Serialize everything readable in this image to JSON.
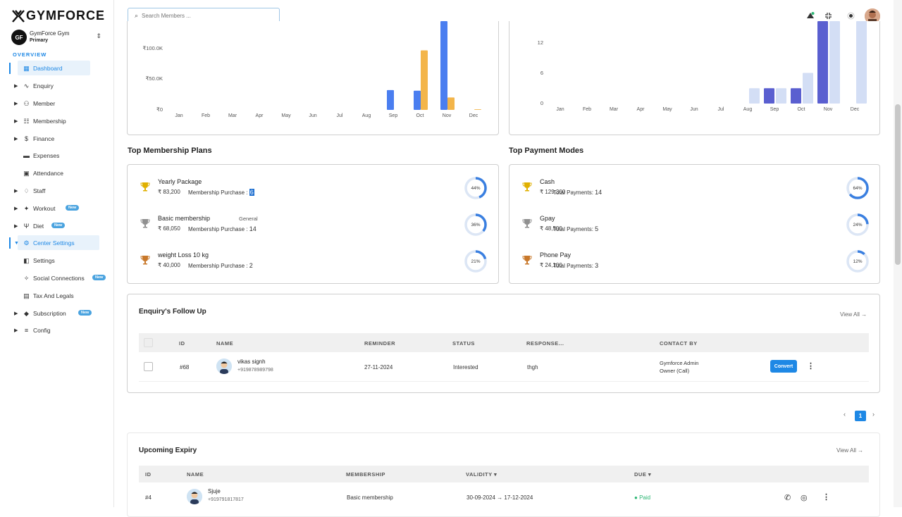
{
  "brand": {
    "logo_text": "GYMFORCE",
    "gym_name": "GymForce Gym",
    "gym_role": "Primary",
    "gym_initials": "GF"
  },
  "sidebar": {
    "section": "OVERVIEW",
    "items": [
      {
        "label": "Dashboard",
        "icon": "grid-icon",
        "new": false
      },
      {
        "label": "Enquiry",
        "icon": "chart-line-icon",
        "new": false
      },
      {
        "label": "Member",
        "icon": "users-icon",
        "new": false
      },
      {
        "label": "Membership",
        "icon": "membership-icon",
        "new": false
      },
      {
        "label": "Finance",
        "icon": "dollar-circle-icon",
        "new": false
      },
      {
        "label": "Expenses",
        "icon": "wallet-icon",
        "new": false
      },
      {
        "label": "Attendance",
        "icon": "calendar-check-icon",
        "new": false
      },
      {
        "label": "Staff",
        "icon": "staff-icon",
        "new": false
      },
      {
        "label": "Workout",
        "icon": "workout-icon",
        "new": true
      },
      {
        "label": "Diet",
        "icon": "utensils-icon",
        "new": true
      },
      {
        "label": "Center Settings",
        "icon": "settings-icon",
        "new": false
      },
      {
        "label": "Settings",
        "icon": "toggle-icon",
        "new": false
      },
      {
        "label": "Social Connections",
        "icon": "social-icon",
        "new": true
      },
      {
        "label": "Tax And Legals",
        "icon": "document-icon",
        "new": false
      },
      {
        "label": "Subscription",
        "icon": "tag-icon",
        "new": true
      },
      {
        "label": "Config",
        "icon": "sliders-icon",
        "new": false
      }
    ],
    "new_badge": "New"
  },
  "search": {
    "placeholder": "Search Members ..."
  },
  "chart_data": [
    {
      "type": "bar",
      "categories": [
        "Jan",
        "Feb",
        "Mar",
        "Apr",
        "May",
        "Jun",
        "Jul",
        "Aug",
        "Sep",
        "Oct",
        "Nov",
        "Dec"
      ],
      "y_ticks": [
        "₹100.0K",
        "₹50.0K",
        "₹0"
      ],
      "series": [
        {
          "values": [
            0,
            0,
            0,
            0,
            0,
            0,
            0,
            0,
            32000,
            31000,
            150000,
            0
          ],
          "color": "#4a7ef0"
        },
        {
          "values": [
            0,
            0,
            0,
            0,
            0,
            0,
            0,
            0,
            0,
            96000,
            20000,
            1000
          ],
          "color": "#f3b54a"
        }
      ]
    },
    {
      "type": "bar",
      "categories": [
        "Jan",
        "Feb",
        "Mar",
        "Apr",
        "May",
        "Jun",
        "Jul",
        "Aug",
        "Sep",
        "Oct",
        "Nov",
        "Dec"
      ],
      "y_ticks": [
        "12",
        "6",
        "0"
      ],
      "series": [
        {
          "values": [
            0,
            0,
            0,
            0,
            0,
            0,
            0,
            0,
            3,
            3,
            18,
            0
          ],
          "color": "#5a5fd0"
        },
        {
          "values": [
            0,
            0,
            0,
            0,
            0,
            0,
            0,
            3,
            3,
            6,
            18,
            18
          ],
          "color": "#d3def5"
        }
      ]
    }
  ],
  "plans": {
    "title": "Top Membership Plans",
    "items": [
      {
        "name": "Yearly Package",
        "amount": "₹ 83,200",
        "count_label": "Membership Purchase :",
        "count": "6",
        "pct": "44%",
        "pct_value": 44,
        "tag": "",
        "trophy": "#e0b000"
      },
      {
        "name": "Basic membership",
        "amount": "₹ 68,050",
        "count_label": "Membership Purchase :",
        "count": "14",
        "pct": "36%",
        "pct_value": 36,
        "tag": "General",
        "trophy": "#909090"
      },
      {
        "name": "weight Loss 10 kg",
        "amount": "₹ 40,000",
        "count_label": "Membership Purchase :",
        "count": "2",
        "pct": "21%",
        "pct_value": 21,
        "tag": "",
        "trophy": "#c8782a"
      }
    ]
  },
  "payments": {
    "title": "Top Payment Modes",
    "items": [
      {
        "name": "Cash",
        "amount": "₹ 129,300",
        "count_label": "Total Payments:",
        "count": "14",
        "pct": "64%",
        "pct_value": 64,
        "trophy": "#e0b000"
      },
      {
        "name": "Gpay",
        "amount": "₹ 48,500",
        "count_label": "Total Payments:",
        "count": "5",
        "pct": "24%",
        "pct_value": 24,
        "trophy": "#909090"
      },
      {
        "name": "Phone Pay",
        "amount": "₹ 24,100",
        "count_label": "Total Payments:",
        "count": "3",
        "pct": "12%",
        "pct_value": 12,
        "trophy": "#c8782a"
      }
    ]
  },
  "enquiry": {
    "title": "Enquiry's Follow Up",
    "view_all": "View All →",
    "columns": [
      "ID",
      "NAME",
      "REMINDER",
      "STATUS",
      "RESPONSE...",
      "CONTACT BY"
    ],
    "rows": [
      {
        "id": "#68",
        "name": "vikas signh",
        "phone": "+919878989798",
        "reminder": "27-11-2024",
        "status": "Interested",
        "response": "thgh",
        "contact1": "Gymforce Admin",
        "contact2": "Owner (Call)",
        "action": "Convert"
      }
    ]
  },
  "pagination": {
    "current": "1",
    "prev": "‹",
    "next": "›"
  },
  "expiry": {
    "title": "Upcoming Expiry",
    "view_all": "View All →",
    "columns": [
      "ID",
      "NAME",
      "MEMBERSHIP",
      "VALIDITY ▾",
      "DUE ▾"
    ],
    "rows": [
      {
        "id": "#4",
        "name": "Sjuje",
        "phone": "+919791817817",
        "membership": "Basic membership",
        "validity": "30-09-2024 → 17-12-2024",
        "due": "Paid"
      }
    ]
  }
}
